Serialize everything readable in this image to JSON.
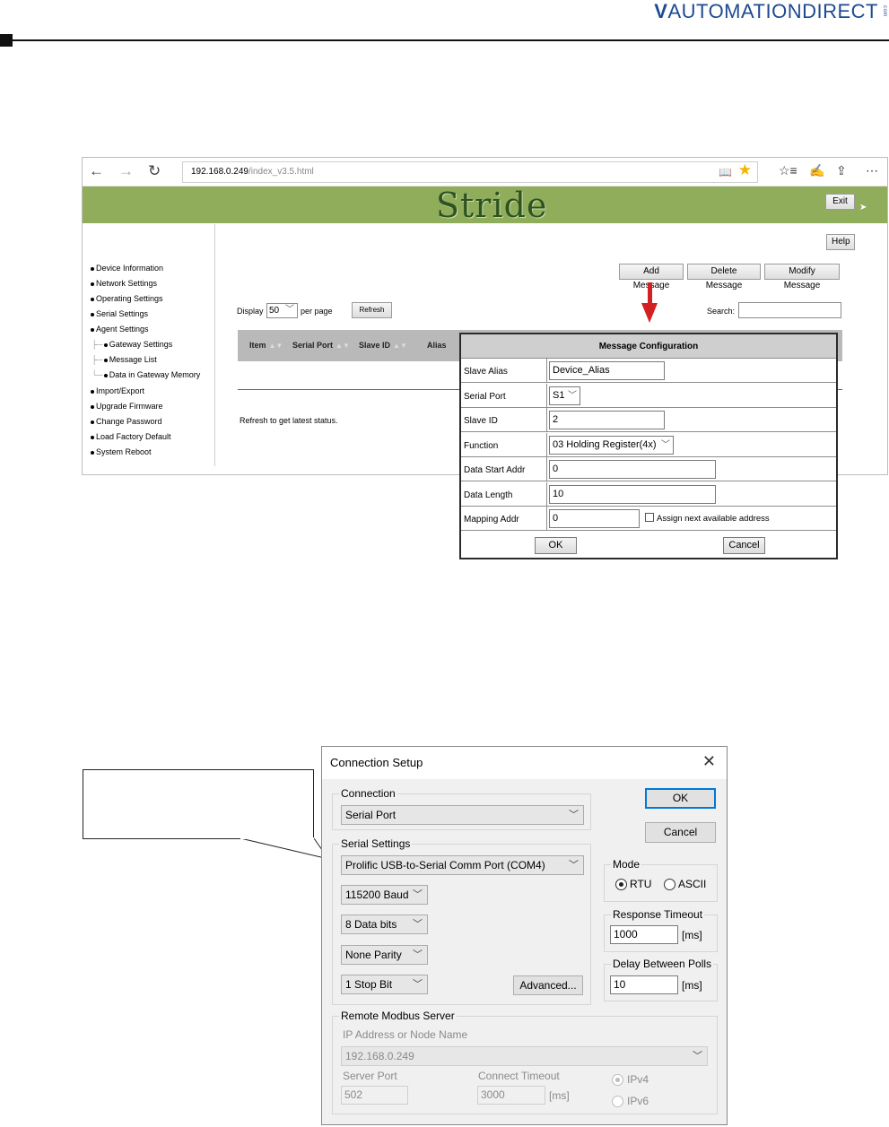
{
  "page_header": {
    "brand": "AUTOMATIONDIRECT",
    "brand_suffix": "com"
  },
  "browser": {
    "url_host": "192.168.0.249",
    "url_path": "/index_v3.5.html",
    "logo": "Stride",
    "exit_label": "Exit",
    "help_label": "Help",
    "menu": [
      "Device Information",
      "Network Settings",
      "Operating Settings",
      "Serial Settings",
      "Agent Settings"
    ],
    "submenu": [
      "Gateway Settings",
      "Message List",
      "Data in Gateway Memory"
    ],
    "menu2": [
      "Import/Export",
      "Upgrade Firmware",
      "Change Password",
      "Load Factory Default",
      "System Reboot"
    ],
    "actions": {
      "add": "Add Message",
      "delete": "Delete Message",
      "modify": "Modify Message"
    },
    "display_label": "Display",
    "display_value": "50",
    "per_page_label": "per page",
    "refresh_label": "Refresh",
    "search_label": "Search:",
    "table_headers": [
      "Item",
      "Serial Port",
      "Slave ID",
      "Alias"
    ],
    "status_text": "Refresh to get latest status."
  },
  "message_config": {
    "title": "Message Configuration",
    "rows": [
      {
        "label": "Slave Alias",
        "value": "Device_Alias"
      },
      {
        "label": "Serial Port",
        "value": "S1"
      },
      {
        "label": "Slave ID",
        "value": "2"
      },
      {
        "label": "Function",
        "value": "03 Holding Register(4x)"
      },
      {
        "label": "Data Start Addr",
        "value": "0"
      },
      {
        "label": "Data Length",
        "value": "10"
      },
      {
        "label": "Mapping Addr",
        "value": "0"
      }
    ],
    "assign_label": "Assign next available address",
    "ok_label": "OK",
    "cancel_label": "Cancel"
  },
  "connection_setup": {
    "title": "Connection Setup",
    "connection_group": "Connection",
    "connection_value": "Serial Port",
    "serial_group": "Serial Settings",
    "port_value": "Prolific USB-to-Serial Comm Port (COM4)",
    "baud_value": "115200 Baud",
    "databits_value": "8 Data bits",
    "parity_value": "None Parity",
    "stopbit_value": "1 Stop Bit",
    "advanced_label": "Advanced...",
    "ok_label": "OK",
    "cancel_label": "Cancel",
    "mode_group": "Mode",
    "mode_rtu": "RTU",
    "mode_ascii": "ASCII",
    "response_group": "Response Timeout",
    "response_value": "1000",
    "delay_group": "Delay Between Polls",
    "delay_value": "10",
    "unit_ms": "[ms]",
    "remote_group": "Remote Modbus Server",
    "ip_label": "IP Address or Node Name",
    "ip_value": "192.168.0.249",
    "server_port_label": "Server Port",
    "server_port_value": "502",
    "connect_timeout_label": "Connect Timeout",
    "connect_timeout_value": "3000",
    "ipv4": "IPv4",
    "ipv6": "IPv6"
  }
}
